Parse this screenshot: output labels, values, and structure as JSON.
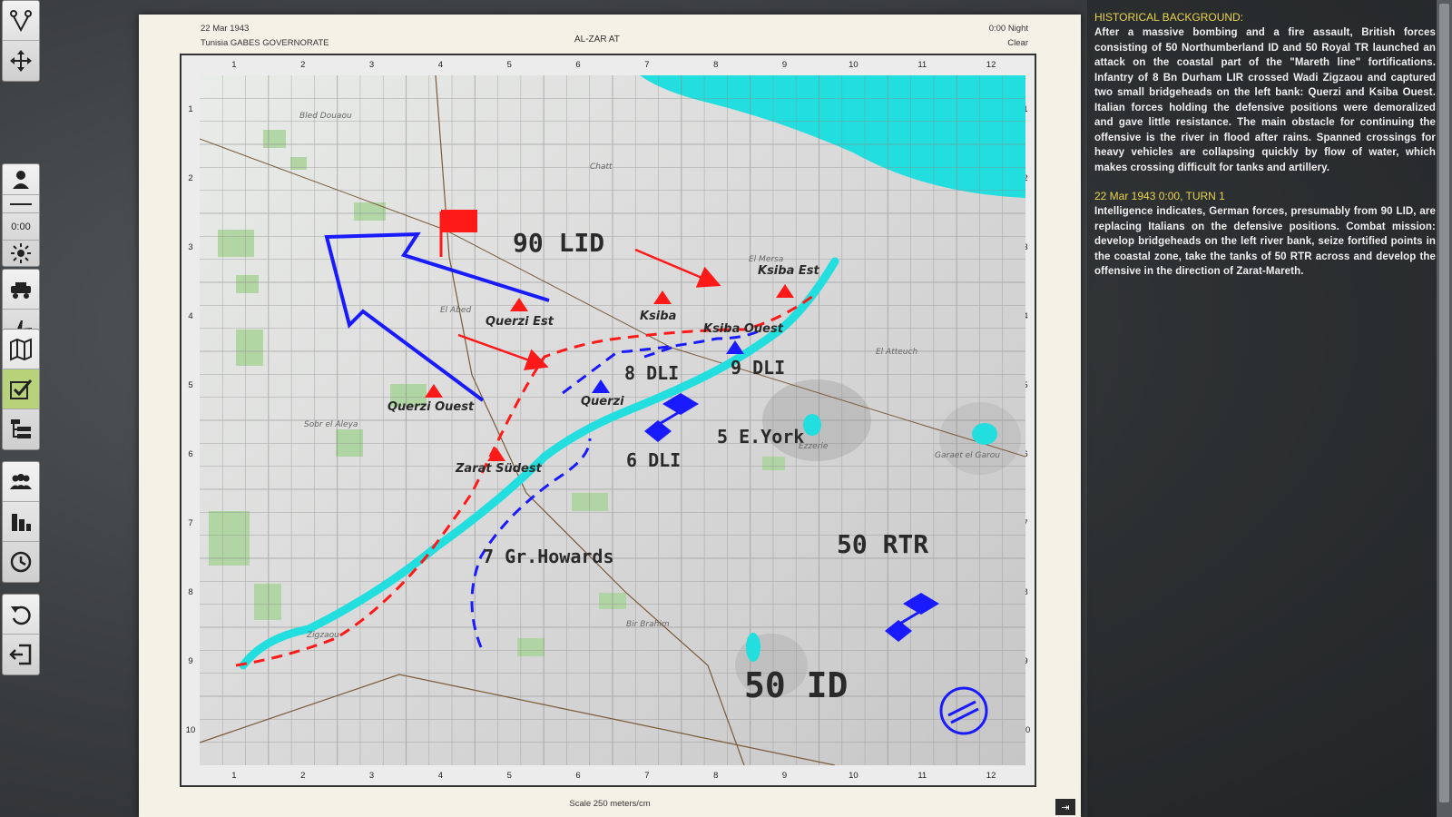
{
  "toolbar": {
    "time": "0:00",
    "tools": [
      "route-tool",
      "move-tool",
      "unit-tool",
      "time-tool",
      "weather-tool",
      "vehicle-tool",
      "aircraft-tool",
      "map-tool",
      "orders-tool",
      "hierarchy-tool",
      "forces-tool",
      "stats-tool",
      "clock-tool",
      "undo-tool",
      "exit-tool"
    ]
  },
  "map_header": {
    "date": "22 Mar 1943",
    "region": "Tunisia GABES GOVERNORATE",
    "title": "AL-ZAR AT",
    "time": "0:00 Night",
    "weather": "Clear"
  },
  "grid": {
    "columns": [
      "1",
      "2",
      "3",
      "4",
      "5",
      "6",
      "7",
      "8",
      "9",
      "10",
      "11",
      "12"
    ],
    "rows": [
      "1",
      "2",
      "3",
      "4",
      "5",
      "6",
      "7",
      "8",
      "9",
      "10"
    ]
  },
  "map_labels": {
    "enemy_div": "90 LID",
    "friendly_div": "50 ID",
    "rtr": "50 RTR",
    "dli8": "8 DLI",
    "dli9": "9 DLI",
    "dli6": "6 DLI",
    "eyork": "5 E.York",
    "howards": "7 Gr.Howards",
    "ksiba_est": "Ksiba Est",
    "ksiba": "Ksiba",
    "ksiba_ouest": "Ksiba Ouest",
    "querzi_est": "Querzi Est",
    "querzi": "Querzi",
    "querzi_ouest": "Querzi Ouest",
    "zarat_sudest": "Zarat Südest",
    "bled": "Bled Douaou",
    "chatt": "Chatt",
    "el_abed": "El Abed",
    "el_mersa": "El Mersa",
    "el_atteuch": "El Atteuch",
    "ezzerie": "Ezzerie",
    "garaet": "Garaet el Garou",
    "bir_brahim": "Bir Brahim",
    "soor": "Sobr el Aleya",
    "zigzaou": "Zigzaou"
  },
  "footer": {
    "scale": "Scale 250 meters/cm",
    "exit_label": "⇥"
  },
  "panel": {
    "bg_title": "HISTORICAL BACKGROUND:",
    "bg_text": "After a massive bombing and a fire assault, British forces consisting of 50 Northumberland ID and 50 Royal TR launched an attack on the coastal part of the \"Mareth line\" fortifications. Infantry of 8 Bn Durham LIR crossed Wadi Zigzaou and captured two small bridgeheads on the left bank: Querzi and Ksiba Ouest. Italian forces holding the defensive positions were demoralized and gave little resistance. The main obstacle for continuing the offensive is the river in flood after rains. Spanned crossings for heavy vehicles are collapsing quickly by flow of water, which makes crossing difficult for tanks and artillery.",
    "turn_title": "22 Mar 1943  0:00, TURN 1",
    "turn_text": "Intelligence indicates, German forces, presumably from 90 LID, are replacing Italians on the defensive positions. Combat mission: develop bridgeheads on the left river bank, seize fortified points in the coastal zone, take the tanks of 50 RTR across and develop the offensive in the direction of Zarat-Mareth."
  },
  "colors": {
    "friendly": "#1a1aff",
    "enemy": "#ff1a1a",
    "water": "#22dede",
    "accent_title": "#e8d44d",
    "active_tool": "#b8d27a"
  }
}
